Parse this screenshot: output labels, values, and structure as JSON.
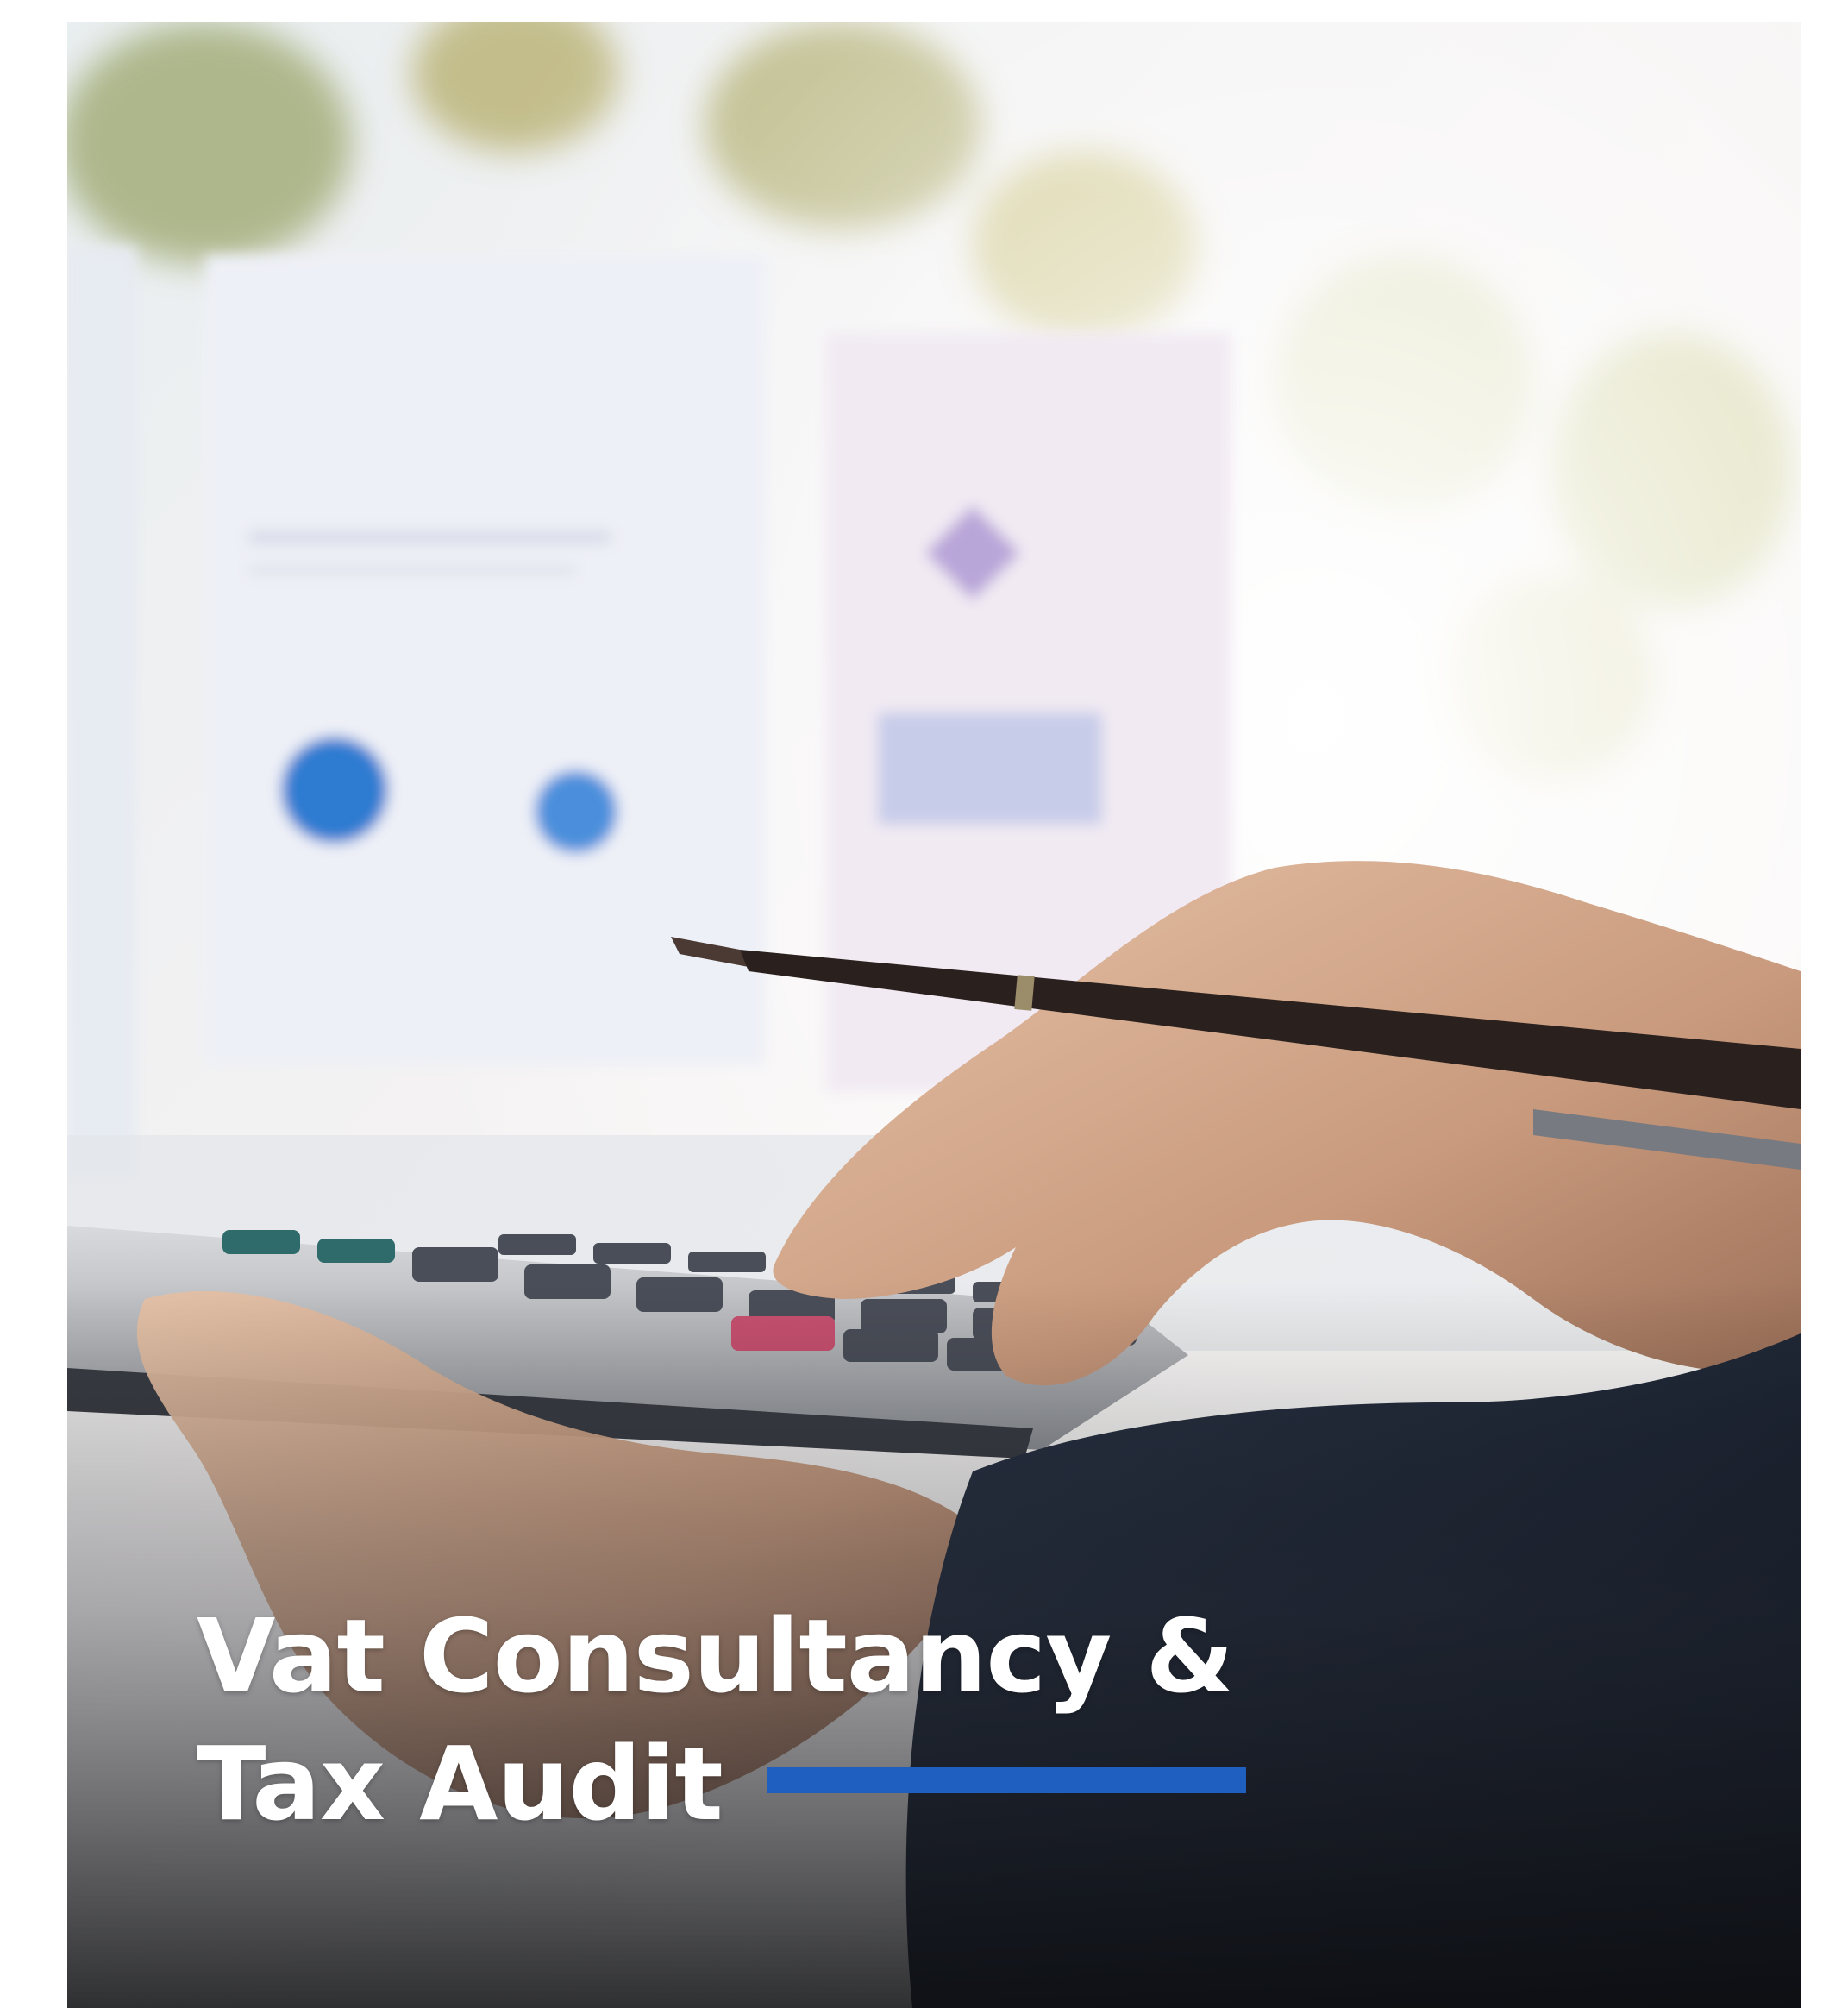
{
  "card": {
    "title_line1": "Vat Consultancy &",
    "title_line2": "Tax Audit"
  },
  "colors": {
    "accent_bar": "#1f5fbf",
    "title_text": "#ffffff"
  },
  "photo": {
    "icon": "calculator-photo"
  }
}
